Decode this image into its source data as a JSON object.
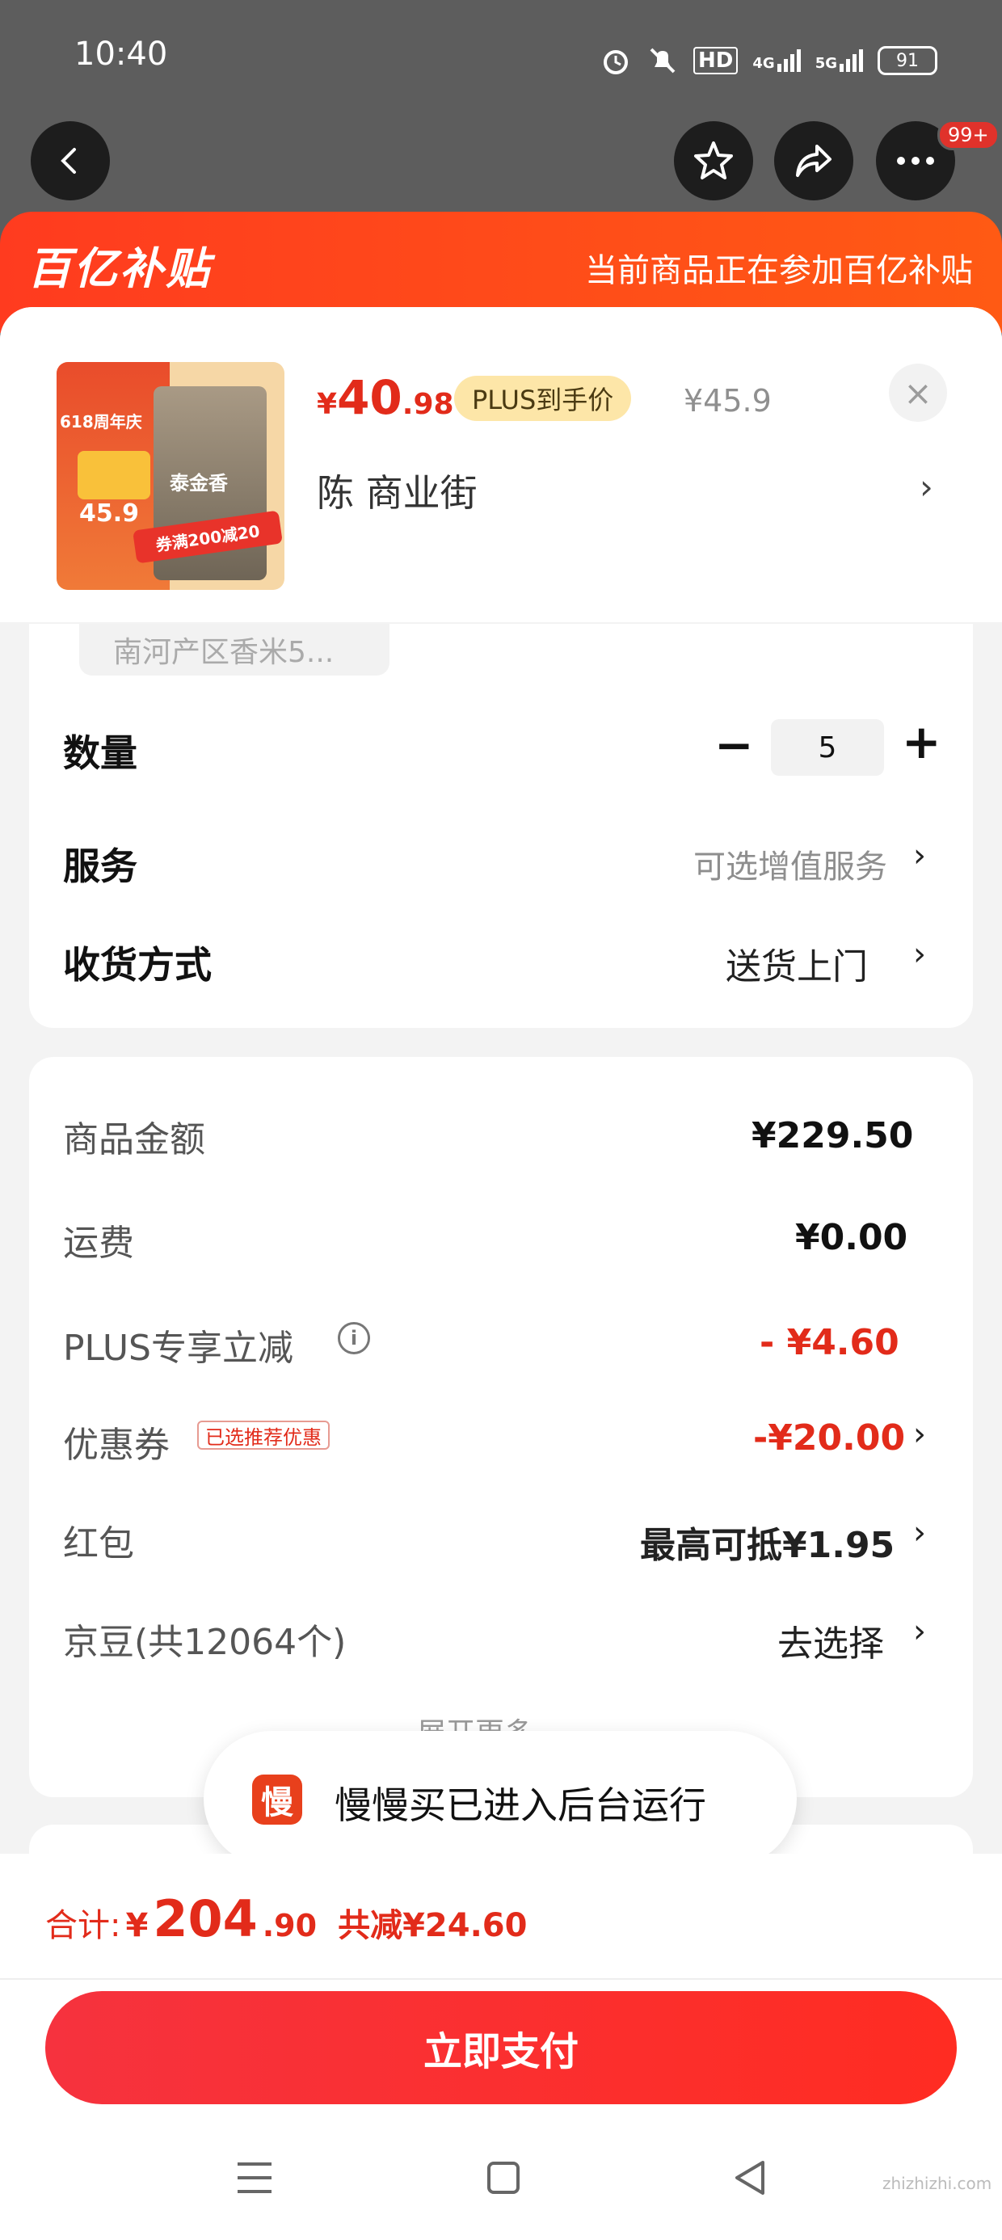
{
  "status_bar": {
    "time": "10:40",
    "network": "4G",
    "network2": "5G",
    "hd": "HD",
    "battery": "91"
  },
  "nav": {
    "badge": "99+"
  },
  "banner": {
    "logo": "百亿补贴",
    "text": "当前商品正在参加百亿补贴"
  },
  "product": {
    "price_symbol": "¥",
    "price_int": "40",
    "price_dec": ".98",
    "plus_tag": "PLUS到手价",
    "original_price": "¥45.9",
    "store": "陈  商业街",
    "close": "×",
    "thumb_badge": "618周年庆",
    "thumb_brand": "泰金香",
    "thumb_promo": "券满200减20",
    "thumb_price": "45.9"
  },
  "variant": {
    "chip": "南河产区香米5..."
  },
  "rows": {
    "quantity_label": "数量",
    "quantity_value": "5",
    "service_label": "服务",
    "service_value": "可选增值服务",
    "delivery_label": "收货方式",
    "delivery_value": "送货上门"
  },
  "fees": {
    "goods_label": "商品金额",
    "goods_value": "¥229.50",
    "shipping_label": "运费",
    "shipping_value": "¥0.00",
    "plus_label": "PLUS专享立减",
    "plus_value": "- ¥4.60",
    "coupon_label": "优惠券",
    "coupon_tag": "已选推荐优惠",
    "coupon_value": "-¥20.00",
    "redpacket_label": "红包",
    "redpacket_value": "最高可抵¥1.95",
    "jingdou_label": "京豆(共12064个)",
    "jingdou_value": "去选择",
    "expand": "展开更多"
  },
  "toast": {
    "icon_text": "慢",
    "text": "慢慢买已进入后台运行"
  },
  "footer": {
    "total_prefix": "合计:",
    "total_symbol": "¥",
    "total_int": "204",
    "total_dec": ".90",
    "save_text": "共减¥24.60",
    "pay_button": "立即支付"
  },
  "watermark": "zhizhizhi.com",
  "colors": {
    "accent_red": "#e22b1a",
    "banner_orange": "#ff4a1a",
    "pay_red": "#f6323e"
  }
}
